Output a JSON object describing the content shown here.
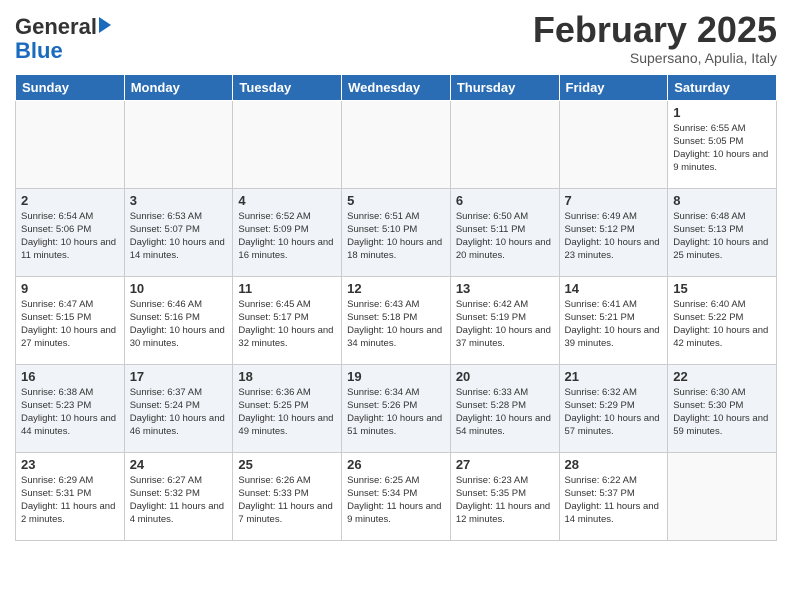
{
  "header": {
    "logo_line1": "General",
    "logo_line2": "Blue",
    "month_title": "February 2025",
    "subtitle": "Supersano, Apulia, Italy"
  },
  "days_of_week": [
    "Sunday",
    "Monday",
    "Tuesday",
    "Wednesday",
    "Thursday",
    "Friday",
    "Saturday"
  ],
  "weeks": [
    {
      "alt": false,
      "days": [
        {
          "num": "",
          "info": ""
        },
        {
          "num": "",
          "info": ""
        },
        {
          "num": "",
          "info": ""
        },
        {
          "num": "",
          "info": ""
        },
        {
          "num": "",
          "info": ""
        },
        {
          "num": "",
          "info": ""
        },
        {
          "num": "1",
          "info": "Sunrise: 6:55 AM\nSunset: 5:05 PM\nDaylight: 10 hours\nand 9 minutes."
        }
      ]
    },
    {
      "alt": true,
      "days": [
        {
          "num": "2",
          "info": "Sunrise: 6:54 AM\nSunset: 5:06 PM\nDaylight: 10 hours\nand 11 minutes."
        },
        {
          "num": "3",
          "info": "Sunrise: 6:53 AM\nSunset: 5:07 PM\nDaylight: 10 hours\nand 14 minutes."
        },
        {
          "num": "4",
          "info": "Sunrise: 6:52 AM\nSunset: 5:09 PM\nDaylight: 10 hours\nand 16 minutes."
        },
        {
          "num": "5",
          "info": "Sunrise: 6:51 AM\nSunset: 5:10 PM\nDaylight: 10 hours\nand 18 minutes."
        },
        {
          "num": "6",
          "info": "Sunrise: 6:50 AM\nSunset: 5:11 PM\nDaylight: 10 hours\nand 20 minutes."
        },
        {
          "num": "7",
          "info": "Sunrise: 6:49 AM\nSunset: 5:12 PM\nDaylight: 10 hours\nand 23 minutes."
        },
        {
          "num": "8",
          "info": "Sunrise: 6:48 AM\nSunset: 5:13 PM\nDaylight: 10 hours\nand 25 minutes."
        }
      ]
    },
    {
      "alt": false,
      "days": [
        {
          "num": "9",
          "info": "Sunrise: 6:47 AM\nSunset: 5:15 PM\nDaylight: 10 hours\nand 27 minutes."
        },
        {
          "num": "10",
          "info": "Sunrise: 6:46 AM\nSunset: 5:16 PM\nDaylight: 10 hours\nand 30 minutes."
        },
        {
          "num": "11",
          "info": "Sunrise: 6:45 AM\nSunset: 5:17 PM\nDaylight: 10 hours\nand 32 minutes."
        },
        {
          "num": "12",
          "info": "Sunrise: 6:43 AM\nSunset: 5:18 PM\nDaylight: 10 hours\nand 34 minutes."
        },
        {
          "num": "13",
          "info": "Sunrise: 6:42 AM\nSunset: 5:19 PM\nDaylight: 10 hours\nand 37 minutes."
        },
        {
          "num": "14",
          "info": "Sunrise: 6:41 AM\nSunset: 5:21 PM\nDaylight: 10 hours\nand 39 minutes."
        },
        {
          "num": "15",
          "info": "Sunrise: 6:40 AM\nSunset: 5:22 PM\nDaylight: 10 hours\nand 42 minutes."
        }
      ]
    },
    {
      "alt": true,
      "days": [
        {
          "num": "16",
          "info": "Sunrise: 6:38 AM\nSunset: 5:23 PM\nDaylight: 10 hours\nand 44 minutes."
        },
        {
          "num": "17",
          "info": "Sunrise: 6:37 AM\nSunset: 5:24 PM\nDaylight: 10 hours\nand 46 minutes."
        },
        {
          "num": "18",
          "info": "Sunrise: 6:36 AM\nSunset: 5:25 PM\nDaylight: 10 hours\nand 49 minutes."
        },
        {
          "num": "19",
          "info": "Sunrise: 6:34 AM\nSunset: 5:26 PM\nDaylight: 10 hours\nand 51 minutes."
        },
        {
          "num": "20",
          "info": "Sunrise: 6:33 AM\nSunset: 5:28 PM\nDaylight: 10 hours\nand 54 minutes."
        },
        {
          "num": "21",
          "info": "Sunrise: 6:32 AM\nSunset: 5:29 PM\nDaylight: 10 hours\nand 57 minutes."
        },
        {
          "num": "22",
          "info": "Sunrise: 6:30 AM\nSunset: 5:30 PM\nDaylight: 10 hours\nand 59 minutes."
        }
      ]
    },
    {
      "alt": false,
      "days": [
        {
          "num": "23",
          "info": "Sunrise: 6:29 AM\nSunset: 5:31 PM\nDaylight: 11 hours\nand 2 minutes."
        },
        {
          "num": "24",
          "info": "Sunrise: 6:27 AM\nSunset: 5:32 PM\nDaylight: 11 hours\nand 4 minutes."
        },
        {
          "num": "25",
          "info": "Sunrise: 6:26 AM\nSunset: 5:33 PM\nDaylight: 11 hours\nand 7 minutes."
        },
        {
          "num": "26",
          "info": "Sunrise: 6:25 AM\nSunset: 5:34 PM\nDaylight: 11 hours\nand 9 minutes."
        },
        {
          "num": "27",
          "info": "Sunrise: 6:23 AM\nSunset: 5:35 PM\nDaylight: 11 hours\nand 12 minutes."
        },
        {
          "num": "28",
          "info": "Sunrise: 6:22 AM\nSunset: 5:37 PM\nDaylight: 11 hours\nand 14 minutes."
        },
        {
          "num": "",
          "info": ""
        }
      ]
    }
  ]
}
